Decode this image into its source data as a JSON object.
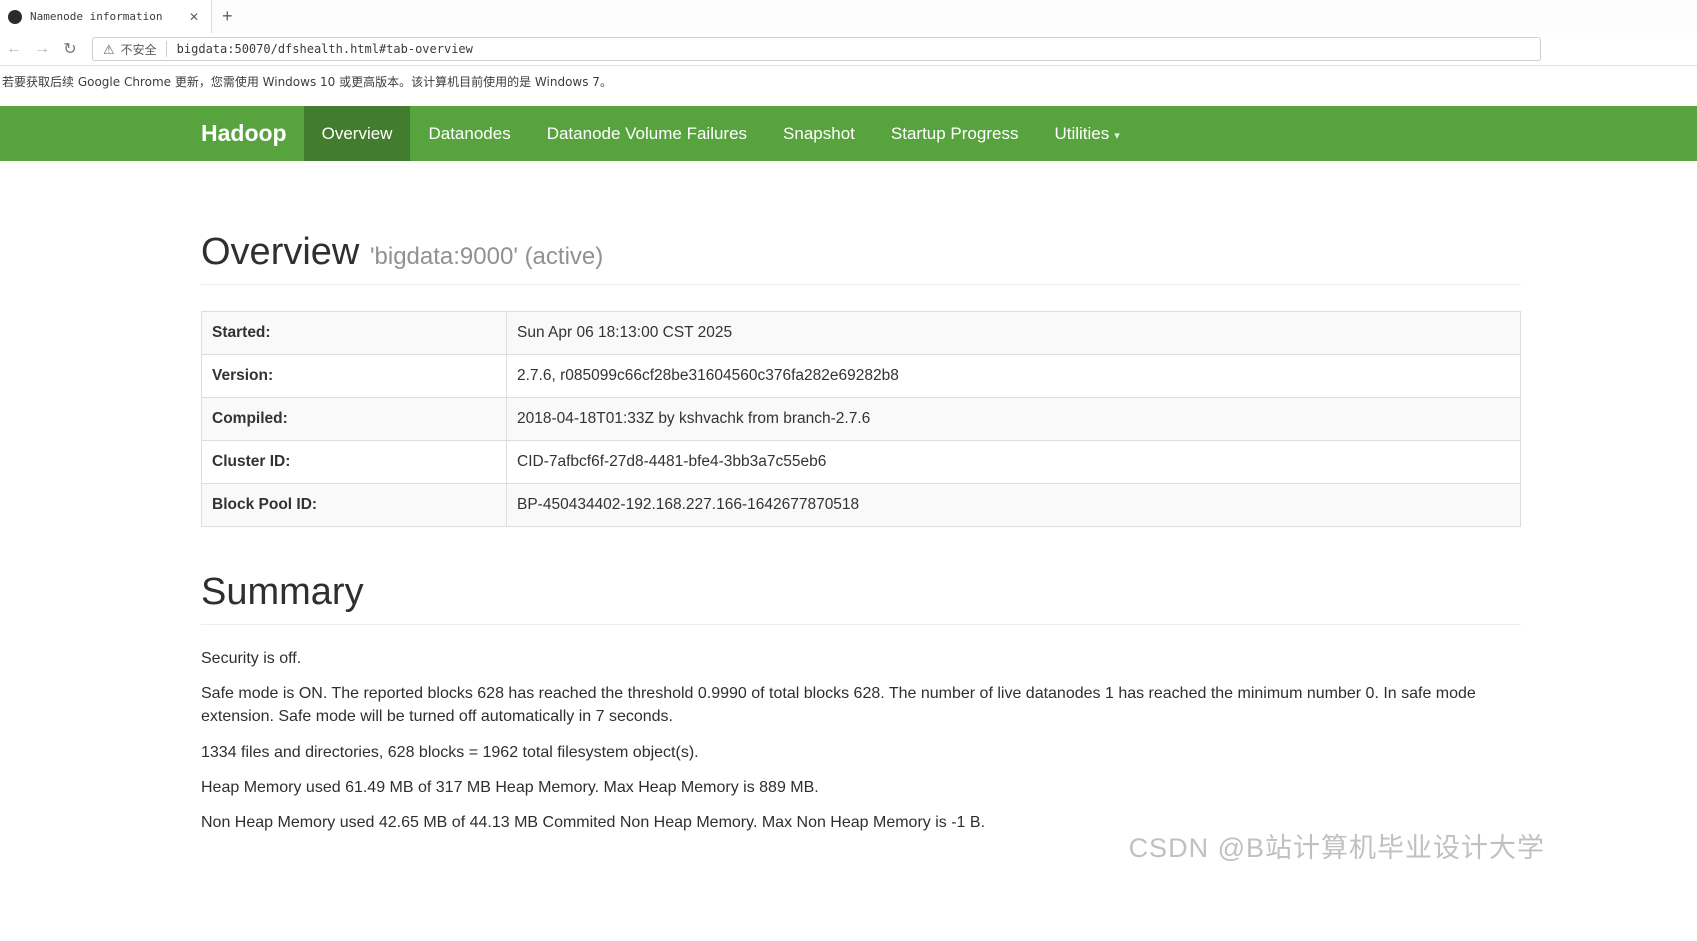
{
  "icons": {
    "back": "←",
    "forward": "→",
    "reload": "↻",
    "close": "✕",
    "new_tab": "+",
    "warning": "⚠",
    "caret": "▾"
  },
  "browser": {
    "tab_title": "Namenode information",
    "security_label": "不安全",
    "url": "bigdata:50070/dfshealth.html#tab-overview",
    "notice": "若要获取后续 Google Chrome 更新，您需使用 Windows 10 或更高版本。该计算机目前使用的是 Windows 7。"
  },
  "navbar": {
    "brand": "Hadoop",
    "items": [
      {
        "label": "Overview"
      },
      {
        "label": "Datanodes"
      },
      {
        "label": "Datanode Volume Failures"
      },
      {
        "label": "Snapshot"
      },
      {
        "label": "Startup Progress"
      },
      {
        "label": "Utilities"
      }
    ]
  },
  "overview": {
    "title": "Overview",
    "subtitle": "'bigdata:9000' (active)",
    "rows": [
      {
        "label": "Started:",
        "value": "Sun Apr 06 18:13:00 CST 2025"
      },
      {
        "label": "Version:",
        "value": "2.7.6, r085099c66cf28be31604560c376fa282e69282b8"
      },
      {
        "label": "Compiled:",
        "value": "2018-04-18T01:33Z by kshvachk from branch-2.7.6"
      },
      {
        "label": "Cluster ID:",
        "value": "CID-7afbcf6f-27d8-4481-bfe4-3bb3a7c55eb6"
      },
      {
        "label": "Block Pool ID:",
        "value": "BP-450434402-192.168.227.166-1642677870518"
      }
    ]
  },
  "summary": {
    "title": "Summary",
    "paragraphs": [
      "Security is off.",
      "Safe mode is ON. The reported blocks 628 has reached the threshold 0.9990 of total blocks 628. The number of live datanodes 1 has reached the minimum number 0. In safe mode extension. Safe mode will be turned off automatically in 7 seconds.",
      "1334 files and directories, 628 blocks = 1962 total filesystem object(s).",
      "Heap Memory used 61.49 MB of 317 MB Heap Memory. Max Heap Memory is 889 MB.",
      "Non Heap Memory used 42.65 MB of 44.13 MB Commited Non Heap Memory. Max Non Heap Memory is -1 B."
    ]
  },
  "watermark": "CSDN @B站计算机毕业设计大学",
  "colors": {
    "navbar_green": "#57a33e",
    "navbar_active": "#427c2d"
  }
}
